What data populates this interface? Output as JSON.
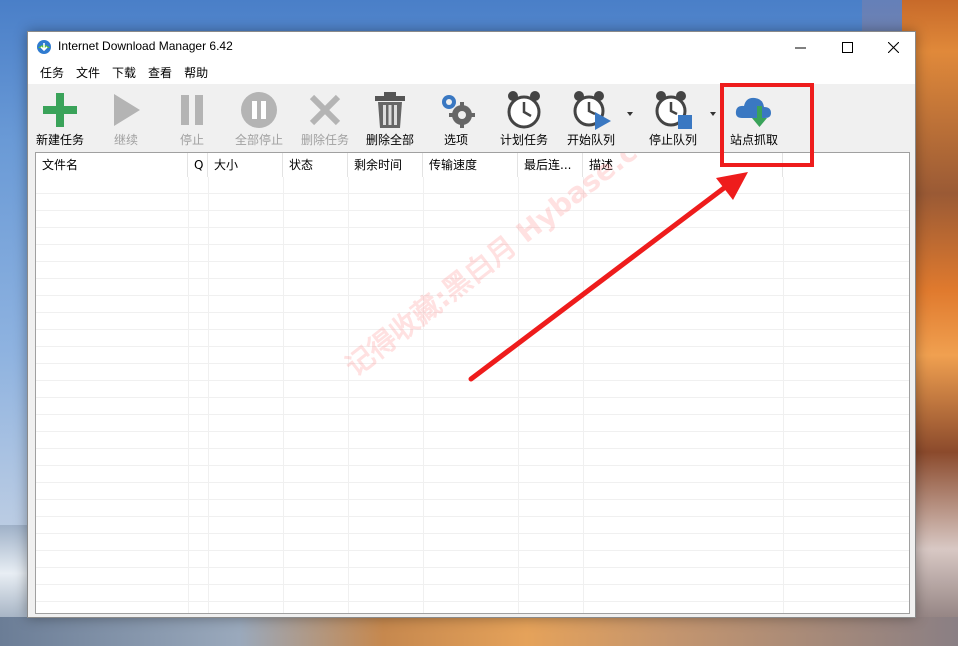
{
  "window": {
    "title": "Internet Download Manager 6.42"
  },
  "menu": [
    "任务",
    "文件",
    "下载",
    "查看",
    "帮助"
  ],
  "toolbar": [
    {
      "label": "新建任务",
      "icon": "plus-icon",
      "enabled": true
    },
    {
      "label": "继续",
      "icon": "play-icon",
      "enabled": false
    },
    {
      "label": "停止",
      "icon": "pause-icon",
      "enabled": false
    },
    {
      "label": "全部停止",
      "icon": "stop-all-icon",
      "enabled": false
    },
    {
      "label": "删除任务",
      "icon": "delete-x-icon",
      "enabled": false
    },
    {
      "label": "删除全部",
      "icon": "trash-icon",
      "enabled": true
    },
    {
      "label": "选项",
      "icon": "gear-icon",
      "enabled": true
    },
    {
      "label": "计划任务",
      "icon": "alarm-clock-icon",
      "enabled": true
    },
    {
      "label": "开始队列",
      "icon": "clock-play-icon",
      "enabled": true
    },
    {
      "label": "停止队列",
      "icon": "clock-stop-icon",
      "enabled": true
    },
    {
      "label": "站点抓取",
      "icon": "cloud-download-icon",
      "enabled": true
    }
  ],
  "columns": [
    "文件名",
    "Q",
    "大小",
    "状态",
    "剩余时间",
    "传输速度",
    "最后连...",
    "描述"
  ],
  "watermark": "记得收藏:黑白月 Hybase.com",
  "colors": {
    "plus_green": "#3aa35a",
    "disabled_gray": "#b4b4b4",
    "queue_blue": "#3a78c2",
    "highlight_red": "#ee1c1c"
  }
}
